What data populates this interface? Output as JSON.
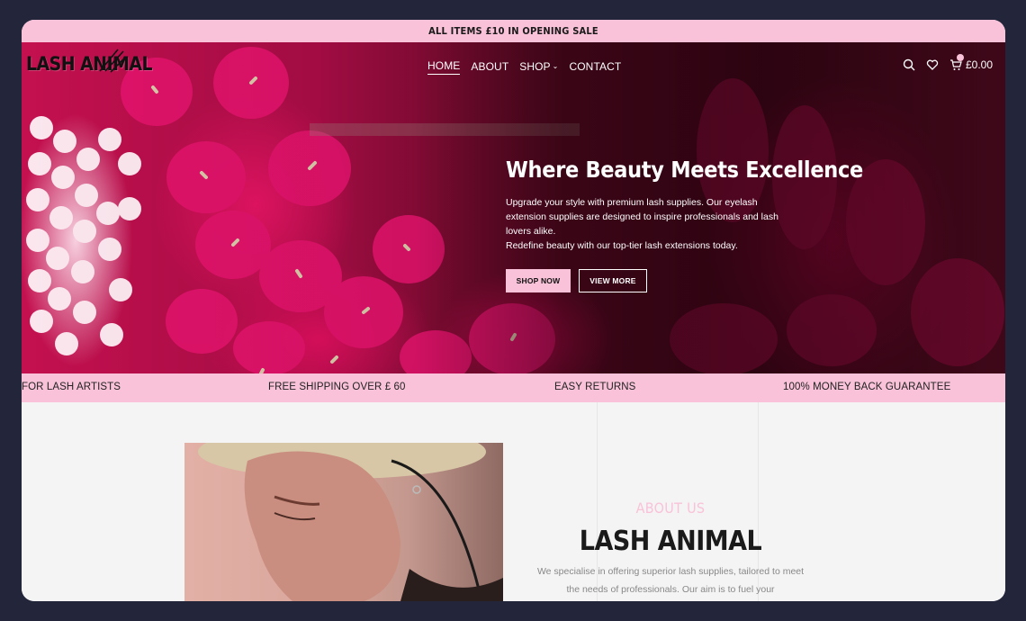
{
  "announcement": "ALL ITEMS £10 IN OPENING SALE",
  "logo": {
    "text_part1": "LASH",
    "text_part2": "ANIMAL"
  },
  "nav": [
    {
      "label": "HOME",
      "active": true
    },
    {
      "label": "ABOUT"
    },
    {
      "label": "SHOP",
      "has_dropdown": true
    },
    {
      "label": "CONTACT"
    }
  ],
  "header_icons": [
    "search-icon",
    "heart-icon",
    "cart-icon"
  ],
  "cart": {
    "total": "£0.00"
  },
  "hero": {
    "title": "Where Beauty Meets Excellence",
    "line1": "Upgrade your style with premium lash supplies. Our eyelash extension supplies are designed to inspire professionals and lash lovers alike.",
    "line2": "Redefine beauty with our top-tier lash extensions today.",
    "primary_button": "SHOP NOW",
    "secondary_button": "VIEW MORE"
  },
  "features": [
    "FOR LASH ARTISTS",
    "FREE SHIPPING OVER £ 60",
    "EASY RETURNS",
    "100% MONEY BACK GUARANTEE"
  ],
  "about": {
    "kicker": "ABOUT US",
    "title": "LASH ANIMAL",
    "body": "We specialise in offering superior lash supplies, tailored to meet the needs of professionals. Our aim is to fuel your"
  },
  "colors": {
    "accent_pink": "#f9c2d8",
    "frame_bg": "#23253a",
    "hero_magenta": "#c4104f"
  }
}
